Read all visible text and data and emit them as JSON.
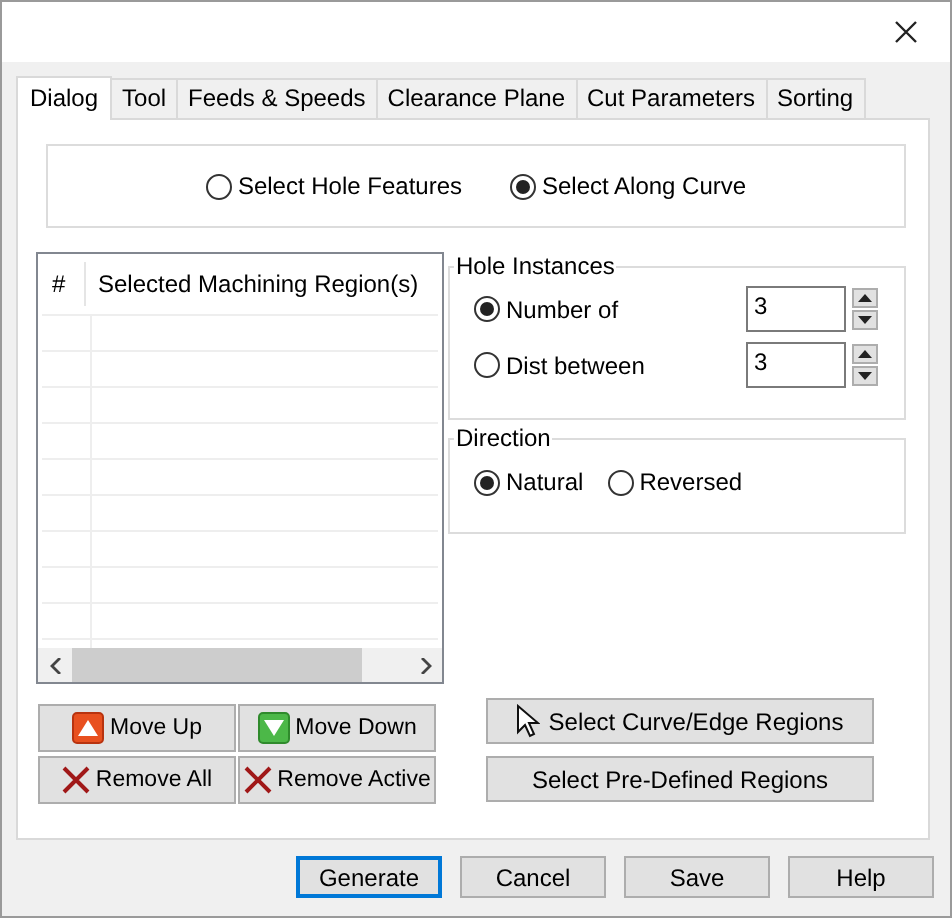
{
  "tabs": [
    {
      "label": "Dialog",
      "selected": true
    },
    {
      "label": "Tool",
      "selected": false
    },
    {
      "label": "Feeds & Speeds",
      "selected": false
    },
    {
      "label": "Clearance Plane",
      "selected": false
    },
    {
      "label": "Cut Parameters",
      "selected": false
    },
    {
      "label": "Sorting",
      "selected": false
    }
  ],
  "selection_mode": [
    {
      "label": "Select Hole Features",
      "selected": false
    },
    {
      "label": "Select Along Curve",
      "selected": true
    }
  ],
  "regions_table": {
    "columns": [
      "#",
      "Selected Machining Region(s)"
    ]
  },
  "list_buttons": [
    {
      "label": "Move Up",
      "kind": "up"
    },
    {
      "label": "Move Down",
      "kind": "down"
    },
    {
      "label": "Remove All",
      "kind": "remove"
    },
    {
      "label": "Remove Active",
      "kind": "remove"
    }
  ],
  "hole_instances": {
    "title": "Hole Instances",
    "options": [
      {
        "label": "Number of",
        "selected": true,
        "value": "3"
      },
      {
        "label": "Dist between",
        "selected": false,
        "value": "3"
      }
    ]
  },
  "direction": {
    "title": "Direction",
    "options": [
      {
        "label": "Natural",
        "selected": true
      },
      {
        "label": "Reversed",
        "selected": false
      }
    ]
  },
  "region_buttons": [
    {
      "label": "Select Curve/Edge Regions",
      "kind": "cursor"
    },
    {
      "label": "Select Pre-Defined Regions",
      "kind": "plain"
    }
  ],
  "footer_buttons": [
    {
      "label": "Generate",
      "focused": true
    },
    {
      "label": "Cancel",
      "focused": false
    },
    {
      "label": "Save",
      "focused": false
    },
    {
      "label": "Help",
      "focused": false
    }
  ]
}
